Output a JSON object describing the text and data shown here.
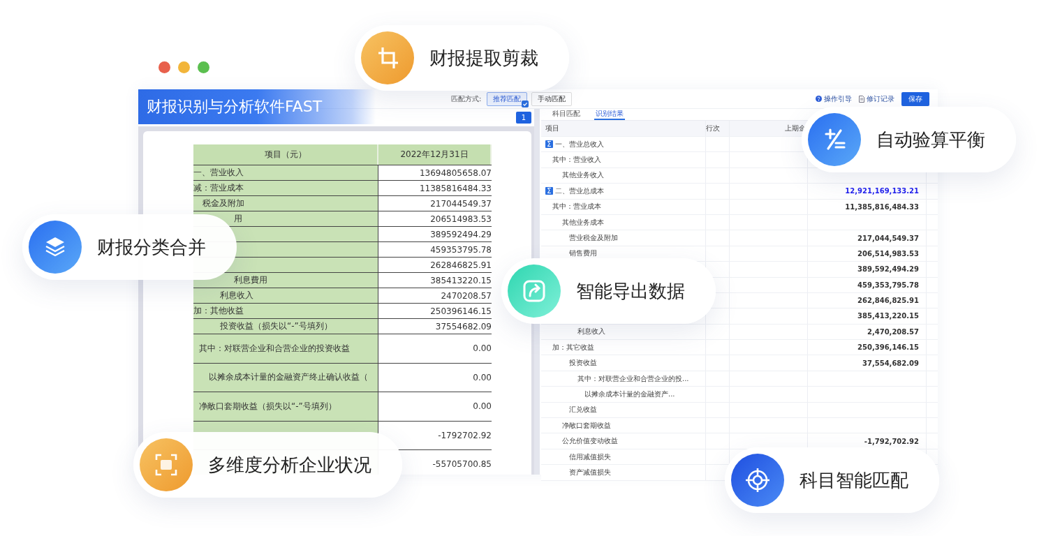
{
  "window": {
    "title": "财报识别与分析软件FAST"
  },
  "toolbar": {
    "match_label": "匹配方式:",
    "match_modes": [
      {
        "label": "推荐匹配",
        "selected": true
      },
      {
        "label": "手动匹配",
        "selected": false
      }
    ],
    "guide_link": "操作引导",
    "history_link": "修订记录",
    "save_button": "保存"
  },
  "document_pane": {
    "page_button": "1",
    "columns": [
      "项目（元）",
      "2022年12月31日"
    ],
    "rows": [
      {
        "kind": "top",
        "label": "一、营业收入",
        "value": "13694805658.07"
      },
      {
        "kind": "top",
        "label": "减：营业成本",
        "value": "11385816484.33"
      },
      {
        "kind": "sub",
        "label": "税金及附加",
        "value": "217044549.37"
      },
      {
        "kind": "deeper",
        "label": "用",
        "value": "206514983.53"
      },
      {
        "kind": "top",
        "value": "389592494.29"
      },
      {
        "kind": "top",
        "value": "459353795.78"
      },
      {
        "kind": "top",
        "value": "262846825.91"
      },
      {
        "kind": "deeper",
        "label": "利息費用",
        "value": "385413220.15"
      },
      {
        "kind": "deep",
        "label": "利息收入",
        "value": "2470208.57"
      },
      {
        "kind": "top",
        "label": "加：其他收益",
        "value": "250396146.15"
      },
      {
        "kind": "deep",
        "label": "投资收益（损失以“-”号填列）",
        "value": "37554682.09"
      },
      {
        "kind": "wide",
        "label": "其中：对联营企业和合营企业的投资收益",
        "value": "0.00"
      },
      {
        "kind": "widedeep",
        "label": "以摊余成本计量的金融资产终止确认收益（",
        "value": "0.00"
      },
      {
        "kind": "wide",
        "label": "净敞口套期收益（损失以“-”号填列）",
        "value": "0.00"
      },
      {
        "kind": "wide",
        "value": "-1792702.92"
      },
      {
        "kind": "wide",
        "value": "-55705700.85"
      }
    ]
  },
  "result_pane": {
    "tabs": [
      {
        "label": "科目匹配",
        "selected": false
      },
      {
        "label": "识别结果",
        "selected": true
      }
    ],
    "columns": [
      "项目",
      "行次",
      "上期金"
    ],
    "rows": [
      {
        "kind": "total",
        "icon": "Σ",
        "label": "一、营业总收入"
      },
      {
        "kind": "first",
        "label": "其中：营业收入"
      },
      {
        "kind": "second",
        "label": "其他业务收入"
      },
      {
        "kind": "total",
        "icon": "Σ",
        "label": "二、营业总成本",
        "value": "12,921,169,133.21"
      },
      {
        "kind": "first",
        "label": "其中：营业成本",
        "value": "11,385,816,484.33"
      },
      {
        "kind": "second",
        "label": "其他业务成本"
      },
      {
        "kind": "third",
        "label": "营业税金及附加",
        "value": "217,044,549.37"
      },
      {
        "kind": "third",
        "label": "销售费用",
        "value": "206,514,983.53"
      },
      {
        "kind": "third",
        "value": "389,592,494.29"
      },
      {
        "kind": "third",
        "value": "459,353,795.78"
      },
      {
        "kind": "third",
        "value": "262,846,825.91"
      },
      {
        "kind": "third",
        "value": "385,413,220.15"
      },
      {
        "kind": "fourth",
        "label": "利息收入",
        "value": "2,470,208.57"
      },
      {
        "kind": "first",
        "label": "加：其它收益",
        "value": "250,396,146.15"
      },
      {
        "kind": "third",
        "label": "投资收益",
        "value": "37,554,682.09"
      },
      {
        "kind": "fourth",
        "label": "其中：对联营企业和合营企业的投..."
      },
      {
        "kind": "fifth",
        "label": "以摊余成本计量的金融资产..."
      },
      {
        "kind": "third",
        "label": "汇兑收益"
      },
      {
        "kind": "second",
        "label": "净敞口套期收益"
      },
      {
        "kind": "second",
        "label": "公允价值变动收益",
        "value": "-1,792,702.92"
      },
      {
        "kind": "third",
        "label": "信用减值损失"
      },
      {
        "kind": "third",
        "label": "资产减值损失"
      }
    ]
  },
  "features": [
    {
      "kind": "crop",
      "label": "财报提取剪裁"
    },
    {
      "kind": "balance",
      "label": "自动验算平衡"
    },
    {
      "kind": "merge",
      "label": "财报分类合并"
    },
    {
      "kind": "export",
      "label": "智能导出数据"
    },
    {
      "kind": "analysis",
      "label": "多维度分析企业状况"
    },
    {
      "kind": "match",
      "label": "科目智能匹配"
    }
  ]
}
